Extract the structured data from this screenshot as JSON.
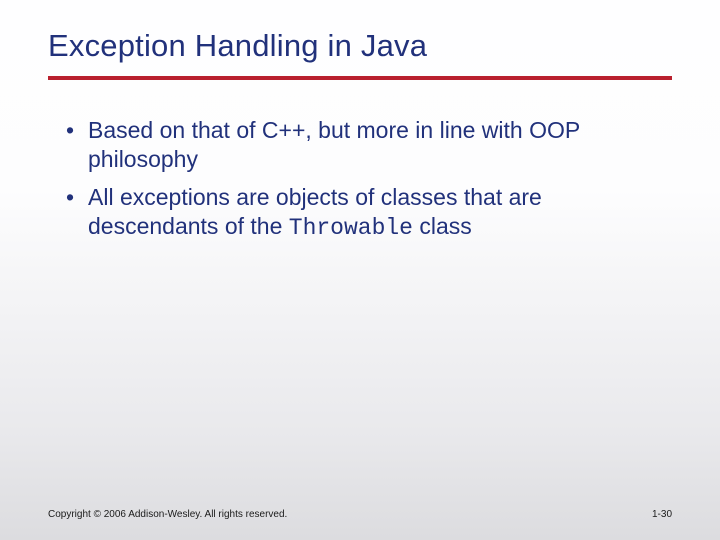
{
  "title": "Exception Handling in Java",
  "bullets": [
    {
      "pre": "Based on that of C++, but more in line with OOP philosophy",
      "mono": "",
      "post": ""
    },
    {
      "pre": "All exceptions are objects of classes that are descendants of the ",
      "mono": "Throwable",
      "post": " class"
    }
  ],
  "footer": {
    "copyright": "Copyright © 2006 Addison-Wesley. All rights reserved.",
    "page": "1-30"
  }
}
